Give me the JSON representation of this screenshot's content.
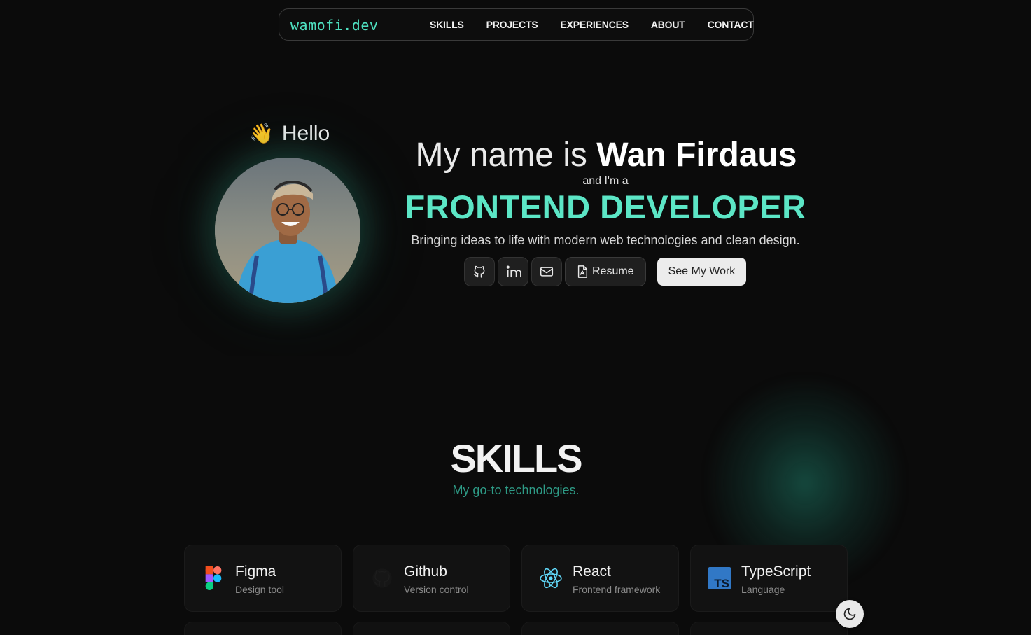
{
  "brand": "wamofi.dev",
  "nav": {
    "links": [
      "SKILLS",
      "PROJECTS",
      "EXPERIENCES",
      "ABOUT",
      "CONTACT"
    ]
  },
  "hero": {
    "greeting": "Hello",
    "greeting_icon": "waving-hand-icon",
    "name_prefix": "My name is ",
    "name": "Wan Firdaus",
    "role_intro": "and I'm a",
    "role": "FRONTEND DEVELOPER",
    "tagline": "Bringing ideas to life with modern web technologies and clean design.",
    "social_icons": [
      "github-icon",
      "linkedin-icon",
      "mail-icon"
    ],
    "resume_label": "Resume",
    "cta_label": "See My Work"
  },
  "skills": {
    "title": "SKILLS",
    "subtitle": "My go-to technologies.",
    "items": [
      {
        "name": "Figma",
        "desc": "Design tool",
        "icon": "figma-icon"
      },
      {
        "name": "Github",
        "desc": "Version control",
        "icon": "github-icon"
      },
      {
        "name": "React",
        "desc": "Frontend framework",
        "icon": "react-icon"
      },
      {
        "name": "TypeScript",
        "desc": "Language",
        "icon": "typescript-icon"
      }
    ]
  },
  "colors": {
    "accent": "#5ce6c6",
    "brand": "#4ee0c0",
    "subtitle": "#2e9b86",
    "background": "#0b0b0b"
  },
  "theme_toggle_icon": "moon-icon"
}
